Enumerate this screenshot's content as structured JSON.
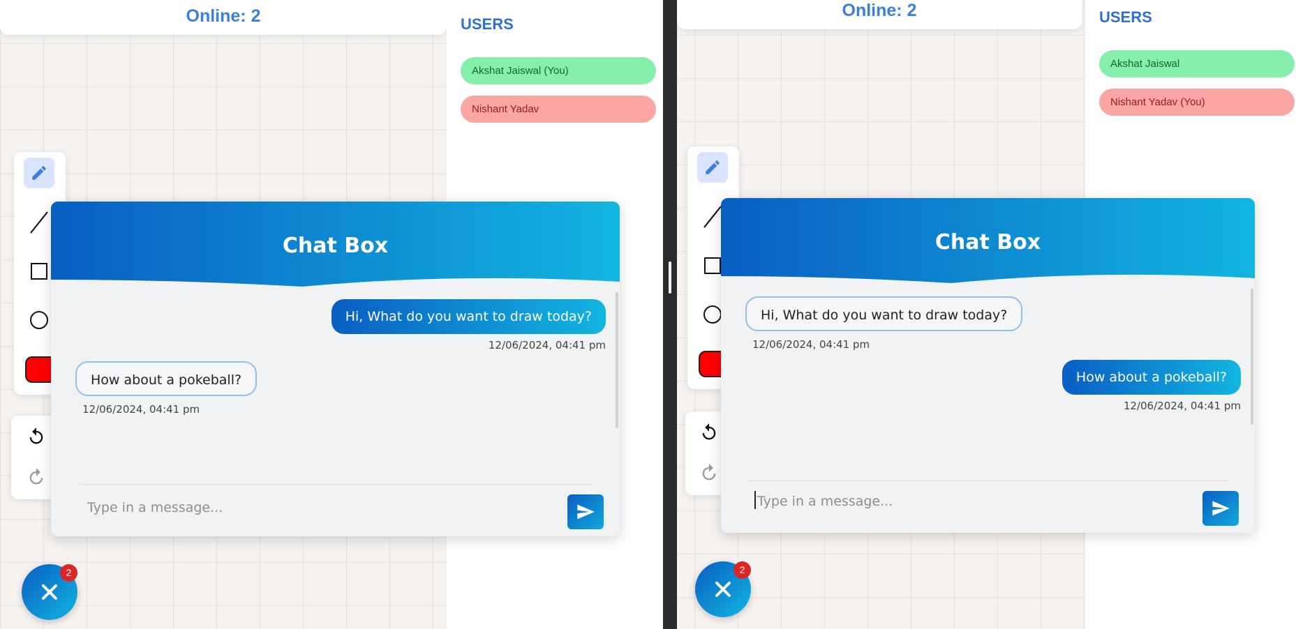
{
  "left": {
    "online_label": "Online: 2",
    "users": {
      "title": "USERS",
      "list": [
        {
          "name": "Akshat Jaiswal (You)",
          "color": "#86efac"
        },
        {
          "name": "Nishant Yadav",
          "color": "#fca5a5"
        }
      ]
    },
    "toolbar": {
      "selected_color": "#ff0000"
    },
    "chat": {
      "title": "Chat Box",
      "messages": [
        {
          "text": "Hi, What do you want to draw today?",
          "time": "12/06/2024, 04:41 pm",
          "from": "me"
        },
        {
          "text": "How about a pokeball?",
          "time": "12/06/2024, 04:41 pm",
          "from": "other"
        }
      ],
      "input_placeholder": "Type in a message...",
      "input_value": ""
    },
    "notification_count": "2"
  },
  "right": {
    "online_label": "Online: 2",
    "users": {
      "title": "USERS",
      "list": [
        {
          "name": "Akshat Jaiswal",
          "color": "#86efac"
        },
        {
          "name": "Nishant Yadav (You)",
          "color": "#fca5a5"
        }
      ]
    },
    "toolbar": {
      "selected_color": "#ff0000"
    },
    "chat": {
      "title": "Chat Box",
      "messages": [
        {
          "text": "Hi, What do you want to draw today?",
          "time": "12/06/2024, 04:41 pm",
          "from": "other"
        },
        {
          "text": "How about a pokeball?",
          "time": "12/06/2024, 04:41 pm",
          "from": "me"
        }
      ],
      "input_placeholder": "Type in a message...",
      "input_value": ""
    },
    "notification_count": "2"
  },
  "colors": {
    "accent": "#3b7fe0",
    "header_gradient_start": "#0a5ec2",
    "header_gradient_end": "#12b5e0",
    "badge": "#dc2626"
  }
}
